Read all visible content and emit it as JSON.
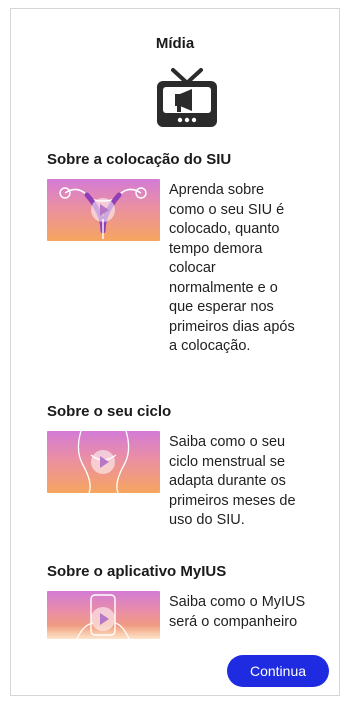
{
  "page": {
    "title": "Mídia",
    "continue_label": "Continua",
    "accent_color": "#1f2be0"
  },
  "media_icon": "tv-megaphone-icon",
  "items": [
    {
      "heading": "Sobre a colocação do SIU",
      "lines": [
        "Aprenda sobre",
        "como o seu SIU é",
        "colocado, quanto",
        "tempo demora",
        "colocar",
        "normalmente e o",
        "que esperar nos",
        "primeiros dias após",
        "a colocação."
      ],
      "thumbnail_icon": "uterus-illustration"
    },
    {
      "heading": "Sobre o seu ciclo",
      "lines": [
        "Saiba como o seu",
        "ciclo menstrual se",
        "adapta durante os",
        "primeiros meses de",
        "uso do SIU."
      ],
      "thumbnail_icon": "body-illustration"
    },
    {
      "heading": "Sobre o aplicativo MyIUS",
      "lines": [
        "Saiba como o MyIUS",
        "será o companheiro"
      ],
      "thumbnail_icon": "phone-hand-illustration"
    }
  ]
}
